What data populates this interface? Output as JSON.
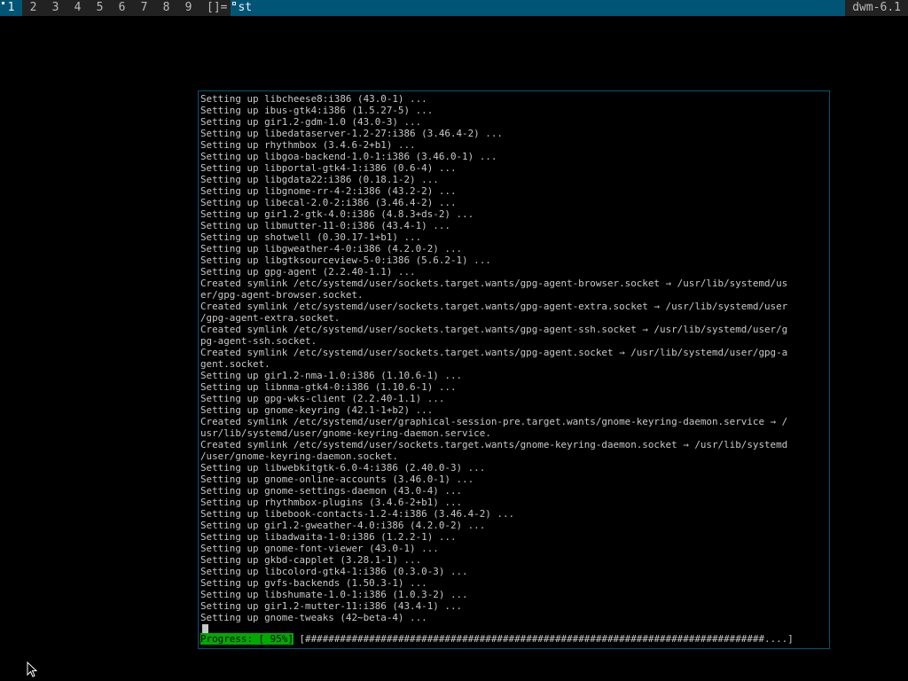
{
  "bar": {
    "tags": [
      {
        "label": "1",
        "active": true,
        "occupied": true,
        "filled": true
      },
      {
        "label": "2",
        "active": false,
        "occupied": false,
        "filled": false
      },
      {
        "label": "3",
        "active": false,
        "occupied": false,
        "filled": false
      },
      {
        "label": "4",
        "active": false,
        "occupied": false,
        "filled": false
      },
      {
        "label": "5",
        "active": false,
        "occupied": false,
        "filled": false
      },
      {
        "label": "6",
        "active": false,
        "occupied": false,
        "filled": false
      },
      {
        "label": "7",
        "active": false,
        "occupied": false,
        "filled": false
      },
      {
        "label": "8",
        "active": false,
        "occupied": false,
        "filled": false
      },
      {
        "label": "9",
        "active": false,
        "occupied": false,
        "filled": false
      }
    ],
    "layout_symbol": "[]=",
    "window_title": "st",
    "status_text": "dwm-6.1"
  },
  "colors": {
    "bar_bg": "#222222",
    "accent": "#005577",
    "progress_bg": "#00aa00"
  },
  "terminal": {
    "lines": [
      "Setting up libcheese8:i386 (43.0-1) ...",
      "Setting up ibus-gtk4:i386 (1.5.27-5) ...",
      "Setting up gir1.2-gdm-1.0 (43.0-3) ...",
      "Setting up libedataserver-1.2-27:i386 (3.46.4-2) ...",
      "Setting up rhythmbox (3.4.6-2+b1) ...",
      "Setting up libgoa-backend-1.0-1:i386 (3.46.0-1) ...",
      "Setting up libportal-gtk4-1:i386 (0.6-4) ...",
      "Setting up libgdata22:i386 (0.18.1-2) ...",
      "Setting up libgnome-rr-4-2:i386 (43.2-2) ...",
      "Setting up libecal-2.0-2:i386 (3.46.4-2) ...",
      "Setting up gir1.2-gtk-4.0:i386 (4.8.3+ds-2) ...",
      "Setting up libmutter-11-0:i386 (43.4-1) ...",
      "Setting up shotwell (0.30.17-1+b1) ...",
      "Setting up libgweather-4-0:i386 (4.2.0-2) ...",
      "Setting up libgtksourceview-5-0:i386 (5.6.2-1) ...",
      "Setting up gpg-agent (2.2.40-1.1) ...",
      "Created symlink /etc/systemd/user/sockets.target.wants/gpg-agent-browser.socket → /usr/lib/systemd/us",
      "er/gpg-agent-browser.socket.",
      "Created symlink /etc/systemd/user/sockets.target.wants/gpg-agent-extra.socket → /usr/lib/systemd/user",
      "/gpg-agent-extra.socket.",
      "Created symlink /etc/systemd/user/sockets.target.wants/gpg-agent-ssh.socket → /usr/lib/systemd/user/g",
      "pg-agent-ssh.socket.",
      "Created symlink /etc/systemd/user/sockets.target.wants/gpg-agent.socket → /usr/lib/systemd/user/gpg-a",
      "gent.socket.",
      "Setting up gir1.2-nma-1.0:i386 (1.10.6-1) ...",
      "Setting up libnma-gtk4-0:i386 (1.10.6-1) ...",
      "Setting up gpg-wks-client (2.2.40-1.1) ...",
      "Setting up gnome-keyring (42.1-1+b2) ...",
      "Created symlink /etc/systemd/user/graphical-session-pre.target.wants/gnome-keyring-daemon.service → /",
      "usr/lib/systemd/user/gnome-keyring-daemon.service.",
      "Created symlink /etc/systemd/user/sockets.target.wants/gnome-keyring-daemon.socket → /usr/lib/systemd",
      "/user/gnome-keyring-daemon.socket.",
      "Setting up libwebkitgtk-6.0-4:i386 (2.40.0-3) ...",
      "Setting up gnome-online-accounts (3.46.0-1) ...",
      "Setting up gnome-settings-daemon (43.0-4) ...",
      "Setting up rhythmbox-plugins (3.4.6-2+b1) ...",
      "Setting up libebook-contacts-1.2-4:i386 (3.46.4-2) ...",
      "Setting up gir1.2-gweather-4.0:i386 (4.2.0-2) ...",
      "Setting up libadwaita-1-0:i386 (1.2.2-1) ...",
      "Setting up gnome-font-viewer (43.0-1) ...",
      "Setting up gkbd-capplet (3.28.1-1) ...",
      "Setting up libcolord-gtk4-1:i386 (0.3.0-3) ...",
      "Setting up gvfs-backends (1.50.3-1) ...",
      "Setting up libshumate-1.0-1:i386 (1.0.3-2) ...",
      "Setting up gir1.2-mutter-11:i386 (43.4-1) ...",
      "Setting up gnome-tweaks (42~beta-4) ..."
    ],
    "progress_label": "Progress: [ 95%]",
    "progress_bar": " [###############################################################################....]"
  }
}
